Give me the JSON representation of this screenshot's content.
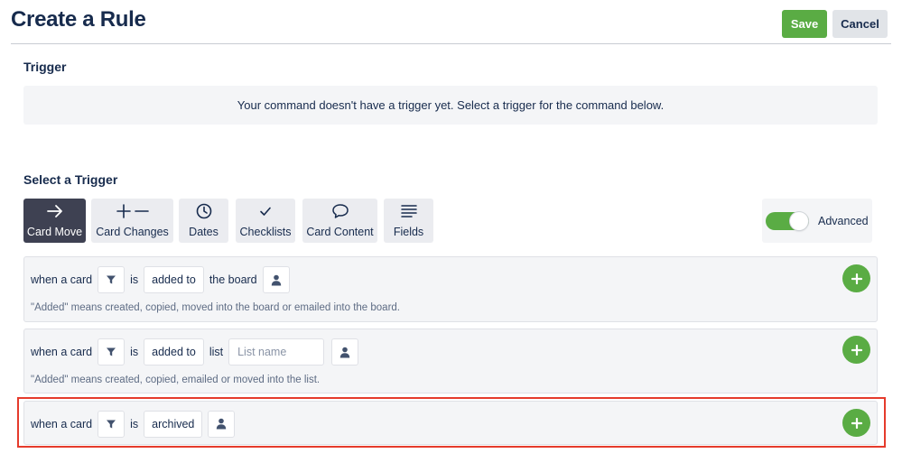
{
  "header": {
    "title": "Create a Rule",
    "save_label": "Save",
    "cancel_label": "Cancel"
  },
  "trigger": {
    "heading": "Trigger",
    "empty_message": "Your command doesn't have a trigger yet. Select a trigger for the command below."
  },
  "select_trigger": {
    "heading": "Select a Trigger",
    "tabs": [
      {
        "label": "Card Move",
        "icon": "arrow-right-icon",
        "active": true
      },
      {
        "label": "Card Changes",
        "icon": "plus-minus-icon",
        "active": false
      },
      {
        "label": "Dates",
        "icon": "clock-icon",
        "active": false
      },
      {
        "label": "Checklists",
        "icon": "check-icon",
        "active": false
      },
      {
        "label": "Card Content",
        "icon": "comment-icon",
        "active": false
      },
      {
        "label": "Fields",
        "icon": "lines-icon",
        "active": false
      }
    ],
    "advanced_label": "Advanced",
    "advanced_on": true
  },
  "rules": [
    {
      "when": "when a card",
      "is": "is",
      "action": "added to",
      "target": "the board",
      "note": "\"Added\" means created, copied, moved into the board or emailed into the board."
    },
    {
      "when": "when a card",
      "is": "is",
      "action": "added to",
      "target": "list",
      "list_placeholder": "List name",
      "note": "\"Added\" means created, copied, emailed or moved into the list."
    },
    {
      "when": "when a card",
      "is": "is",
      "action": "archived",
      "highlighted": true
    }
  ],
  "colors": {
    "accent_green": "#5aac44",
    "active_tab": "#3e4152",
    "highlight_red": "#e53b2c",
    "text": "#172b4d"
  }
}
